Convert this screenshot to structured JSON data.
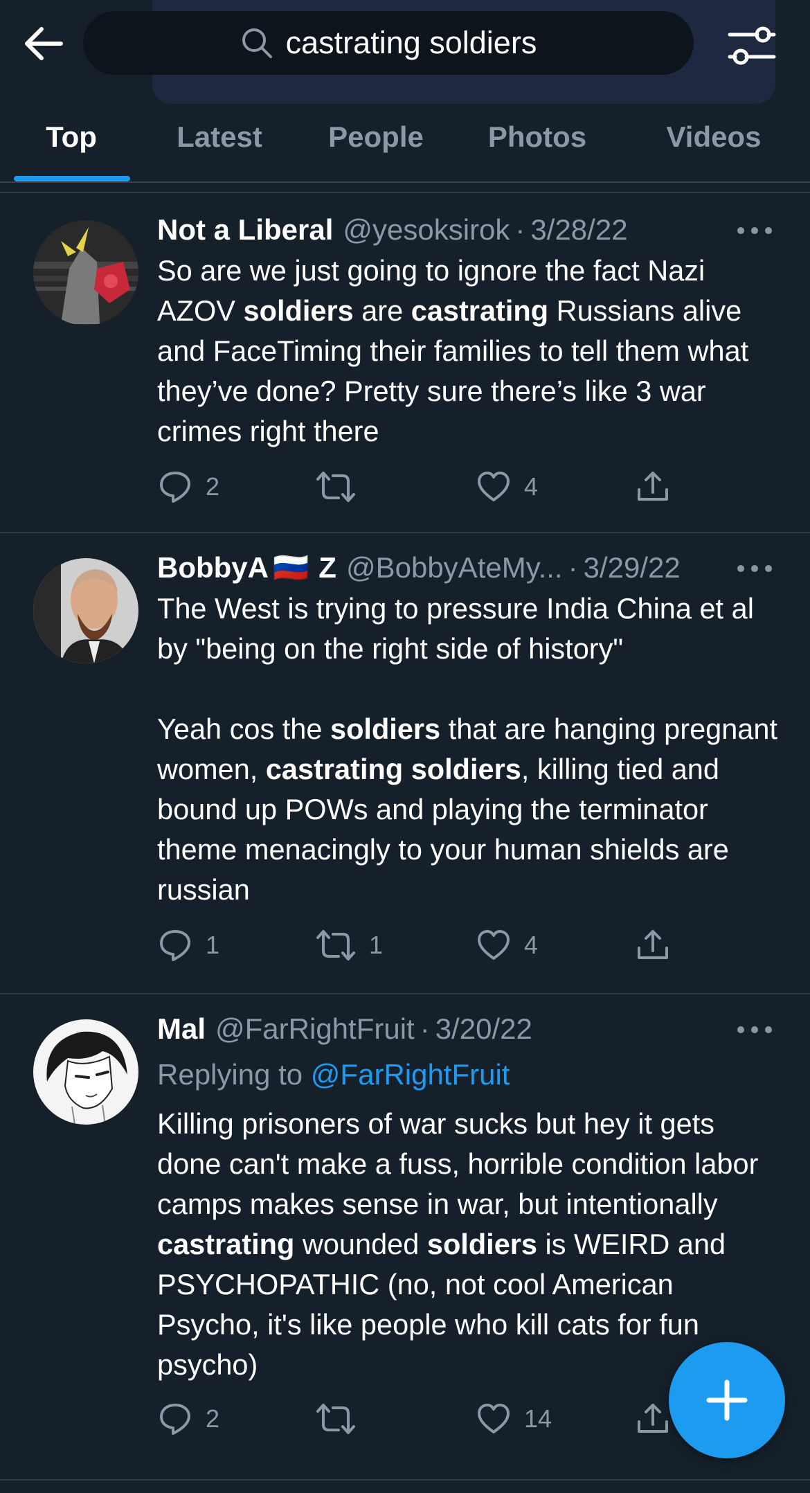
{
  "search": {
    "query": "castrating soldiers"
  },
  "tabs": [
    {
      "label": "Top",
      "active": true
    },
    {
      "label": "Latest",
      "active": false
    },
    {
      "label": "People",
      "active": false
    },
    {
      "label": "Photos",
      "active": false
    },
    {
      "label": "Videos",
      "active": false
    }
  ],
  "colors": {
    "accent": "#1d9bf0",
    "background": "#15202b",
    "muted": "#8b98a5"
  },
  "tweets": [
    {
      "name": "Not a Liberal",
      "handle": "@yesoksirok",
      "dot": "·",
      "date": "3/28/22",
      "body": [
        {
          "t": "So are we just going to ignore the fact Nazi AZOV "
        },
        {
          "t": "soldiers",
          "b": true
        },
        {
          "t": " are "
        },
        {
          "t": "castrating",
          "b": true
        },
        {
          "t": " Russians alive and FaceTiming their families to tell them what they’ve done? Pretty sure there’s like 3 war crimes right there"
        }
      ],
      "replies": "2",
      "retweets": "",
      "likes": "4"
    },
    {
      "name": "BobbyA",
      "name_flag": "🇷🇺",
      "name_suffix": "Z",
      "handle": "@BobbyAteMy...",
      "dot": "·",
      "date": "3/29/22",
      "body_p1": "The West is trying to pressure India China et al by \"being on the right side of history\"",
      "body": [
        {
          "t": "Yeah cos the "
        },
        {
          "t": "soldiers",
          "b": true
        },
        {
          "t": " that are hanging pregnant women, "
        },
        {
          "t": "castrating soldiers",
          "b": true
        },
        {
          "t": ", killing tied and bound up POWs and playing the terminator theme menacingly to your human shields are russian"
        }
      ],
      "replies": "1",
      "retweets": "1",
      "likes": "4"
    },
    {
      "name": "Mal",
      "handle": "@FarRightFruit",
      "dot": "·",
      "date": "3/20/22",
      "replying_prefix": "Replying to",
      "replying_to": "@FarRightFruit",
      "body": [
        {
          "t": "Killing prisoners of war sucks but hey it gets done can't make a fuss, horrible condition labor camps makes sense in war, but intentionally "
        },
        {
          "t": "castrating",
          "b": true
        },
        {
          "t": " wounded "
        },
        {
          "t": "soldiers",
          "b": true
        },
        {
          "t": " is WEIRD and PSYCHOPATHIC (no, not cool American Psycho, it's like people who kill cats for fun psycho)"
        }
      ],
      "replies": "2",
      "retweets": "",
      "likes": "14"
    }
  ],
  "icons": {
    "back": "arrow-left-icon",
    "search": "search-icon",
    "filter": "filter-sliders-icon",
    "reply": "reply-icon",
    "retweet": "retweet-icon",
    "like": "heart-icon",
    "share": "share-icon",
    "more": "more-icon",
    "compose": "plus-icon"
  }
}
